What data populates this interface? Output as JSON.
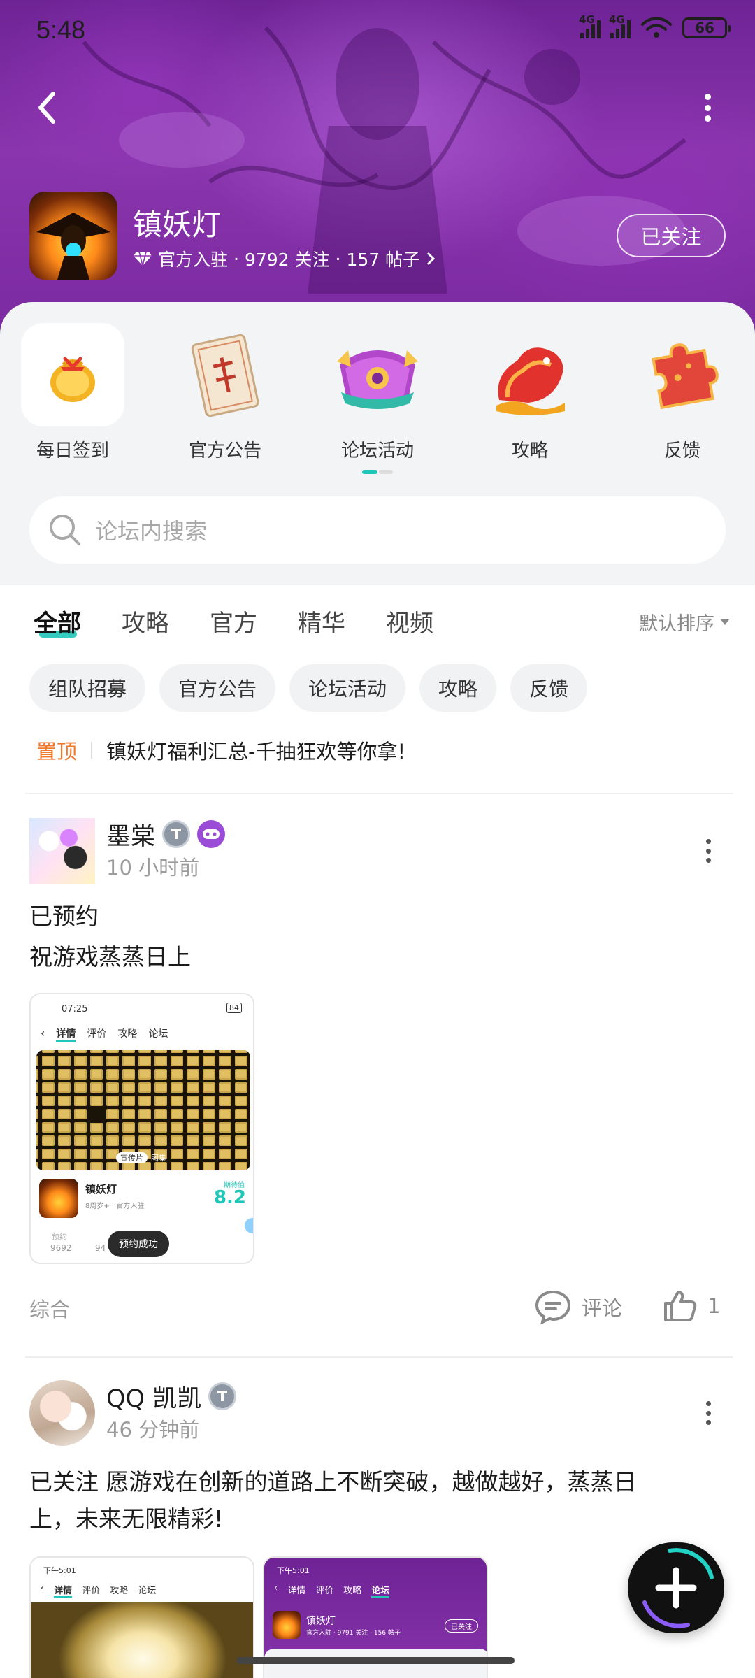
{
  "status_bar": {
    "time": "5:48",
    "signal_1_label": "4G",
    "signal_2_label": "4G",
    "battery": "66"
  },
  "header": {
    "game_title": "镇妖灯",
    "official_label": "官方入驻",
    "followers": "9792 关注",
    "posts": "157 帖子",
    "sep": "·",
    "follow_button": "已关注"
  },
  "quick_entries": [
    {
      "label": "每日签到",
      "icon": "lucky-bag-icon"
    },
    {
      "label": "官方公告",
      "icon": "scroll-icon"
    },
    {
      "label": "论坛活动",
      "icon": "treasure-chest-icon"
    },
    {
      "label": "攻略",
      "icon": "dragon-icon"
    },
    {
      "label": "反馈",
      "icon": "puzzle-icon"
    }
  ],
  "search": {
    "placeholder": "论坛内搜索"
  },
  "tabs": [
    "全部",
    "攻略",
    "官方",
    "精华",
    "视频"
  ],
  "sort_label": "默认排序",
  "chips": [
    "组队招募",
    "官方公告",
    "论坛活动",
    "攻略",
    "反馈"
  ],
  "pinned": {
    "tag": "置顶",
    "text": "镇妖灯福利汇总-千抽狂欢等你拿!"
  },
  "posts": [
    {
      "author": "墨棠",
      "time": "10 小时前",
      "lines": [
        "已预约",
        "祝游戏蒸蒸日上"
      ],
      "category": "综合",
      "comment_label": "评论",
      "likes": "1",
      "screenshot": {
        "time": "07:25",
        "battery": "84",
        "tabs": [
          "详情",
          "评价",
          "攻略",
          "论坛"
        ],
        "badge": "宣传片",
        "badge2": "图集",
        "game": "镇妖灯",
        "game_meta": "8周岁+ · 官方入驻",
        "score_label": "期待值",
        "score": "8.2",
        "stat1_label": "预约",
        "stat1_value": "9692",
        "stat2_value": "94",
        "toast": "预约成功"
      }
    },
    {
      "author": "QQ 凯凯",
      "time": "46 分钟前",
      "lines": [
        "已关注  愿游戏在创新的道路上不断突破，越做越好，蒸蒸日",
        "上，未来无限精彩!"
      ],
      "screenshot1": {
        "time": "下午5:01",
        "tabs": [
          "详情",
          "评价",
          "攻略",
          "论坛"
        ]
      },
      "screenshot2": {
        "time": "下午5:01",
        "tabs": [
          "详情",
          "评价",
          "攻略",
          "论坛"
        ],
        "game": "镇妖灯",
        "meta": "官方入驻 · 9791 关注 · 156 帖子",
        "follow": "已关注"
      }
    }
  ],
  "colors": {
    "accent": "#20c7b8",
    "pin": "#ef7a2e",
    "banner": "#7b2aa1"
  }
}
